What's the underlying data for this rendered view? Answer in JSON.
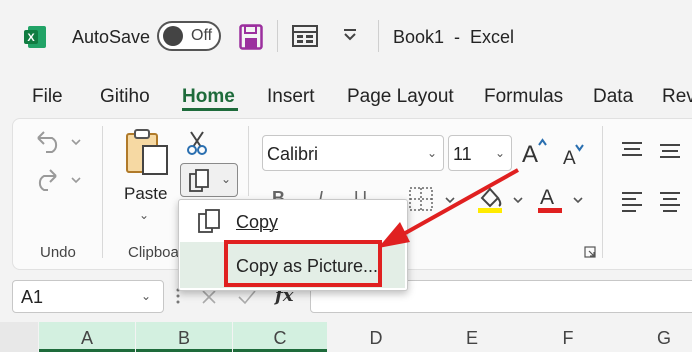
{
  "titlebar": {
    "autosave_label": "AutoSave",
    "autosave_state": "Off",
    "book_title": "Book1  -  Excel"
  },
  "tabs": [
    "File",
    "Gitiho",
    "Home",
    "Insert",
    "Page Layout",
    "Formulas",
    "Data",
    "Rev"
  ],
  "active_tab": "Home",
  "ribbon": {
    "undo_group_label": "Undo",
    "clipboard_group_label": "Clipboa",
    "paste_label": "Paste",
    "font_group_label": "ont",
    "font_name": "Calibri",
    "font_size": "11",
    "font_colors": {
      "highlight": "#ffeb00",
      "font": "#e02020"
    }
  },
  "copy_menu": {
    "copy_label": "Copy",
    "copy_as_picture_label": "Copy as Picture..."
  },
  "formula_bar": {
    "name_box_value": "A1",
    "fx_label": "fx"
  },
  "columns": [
    "A",
    "B",
    "C",
    "D",
    "E",
    "F",
    "G"
  ],
  "colors": {
    "accent": "#1e6b3b",
    "callout": "#e02020"
  }
}
